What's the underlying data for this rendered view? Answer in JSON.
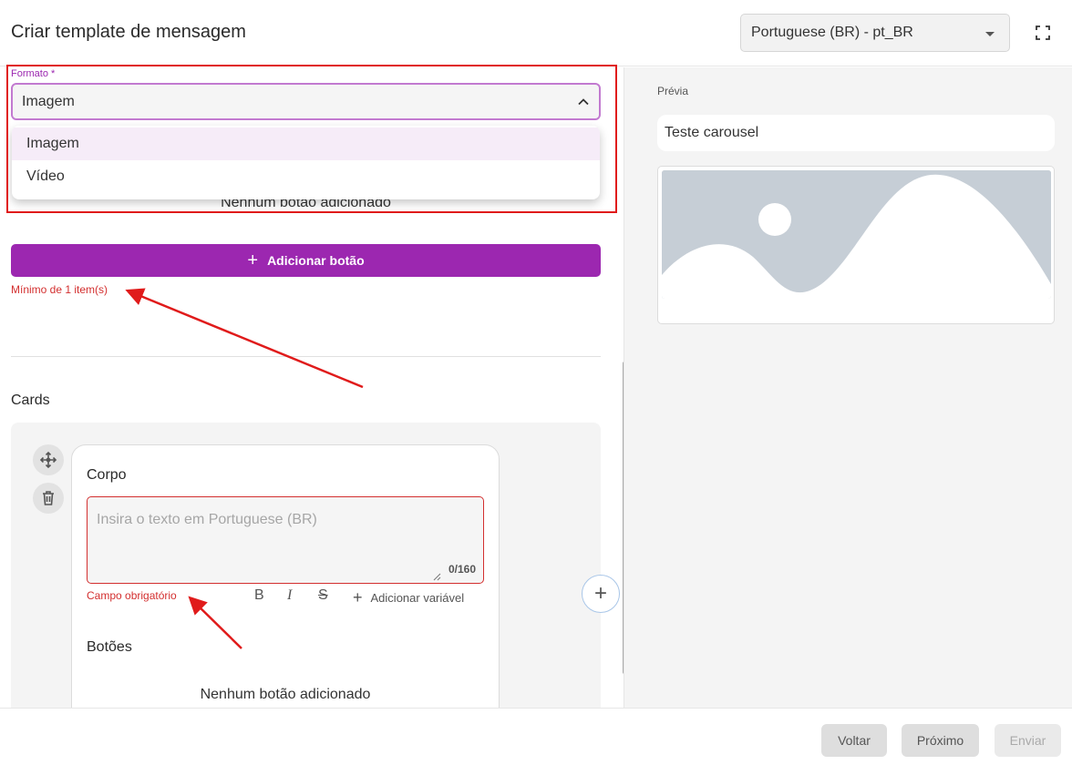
{
  "header": {
    "title": "Criar template de mensagem",
    "language_value": "Portuguese (BR) - pt_BR"
  },
  "form": {
    "formato_label": "Formato *",
    "formato_value": "Imagem",
    "formato_options": [
      "Imagem",
      "Vídeo"
    ],
    "nenhum_botao_text": "Nenhum botão adicionado",
    "add_button_label": "Adicionar botão",
    "min_items_error": "Mínimo de 1 item(s)",
    "cards_title": "Cards"
  },
  "card": {
    "corpo_label": "Corpo",
    "placeholder": "Insira o texto em Portuguese (BR)",
    "counter": "0/160",
    "required_error": "Campo obrigatório",
    "bold_glyph": "B",
    "italic_glyph": "I",
    "strike_glyph": "S",
    "add_variable_label": "Adicionar variável",
    "botoes_label": "Botões",
    "nenhum_botao_text": "Nenhum botão adicionado"
  },
  "preview": {
    "label": "Prévia",
    "text": "Teste carousel"
  },
  "footer": {
    "voltar": "Voltar",
    "proximo": "Próximo",
    "enviar": "Enviar"
  },
  "colors": {
    "accent": "#9c27b0",
    "error": "#d32f2f",
    "annotation": "#e01b1b"
  },
  "icons": [
    "chevron-down-icon",
    "fullscreen-icon",
    "chevron-up-icon",
    "plus-icon",
    "move-icon",
    "trash-icon",
    "resize-handle-icon"
  ]
}
